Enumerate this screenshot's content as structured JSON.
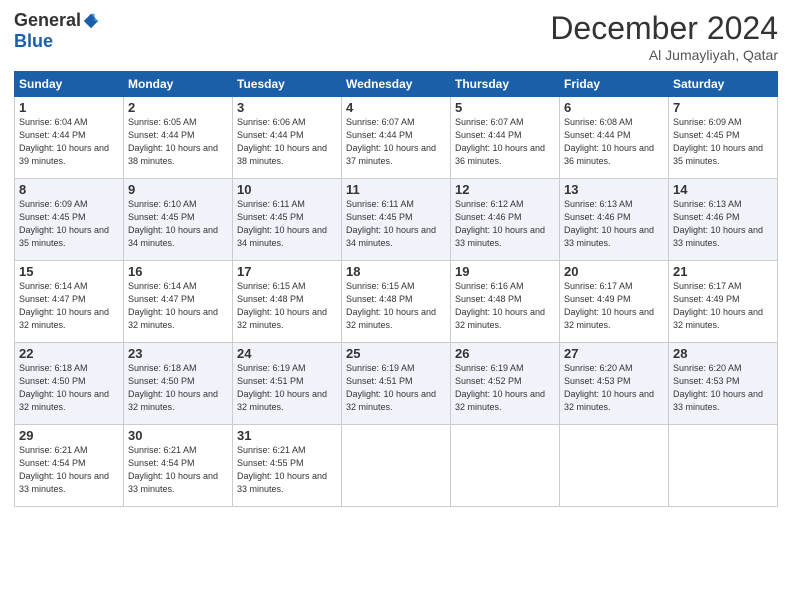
{
  "header": {
    "logo_general": "General",
    "logo_blue": "Blue",
    "month_title": "December 2024",
    "location": "Al Jumayliyah, Qatar"
  },
  "weekdays": [
    "Sunday",
    "Monday",
    "Tuesday",
    "Wednesday",
    "Thursday",
    "Friday",
    "Saturday"
  ],
  "weeks": [
    [
      {
        "day": "1",
        "sunrise": "6:04 AM",
        "sunset": "4:44 PM",
        "daylight": "10 hours and 39 minutes."
      },
      {
        "day": "2",
        "sunrise": "6:05 AM",
        "sunset": "4:44 PM",
        "daylight": "10 hours and 38 minutes."
      },
      {
        "day": "3",
        "sunrise": "6:06 AM",
        "sunset": "4:44 PM",
        "daylight": "10 hours and 38 minutes."
      },
      {
        "day": "4",
        "sunrise": "6:07 AM",
        "sunset": "4:44 PM",
        "daylight": "10 hours and 37 minutes."
      },
      {
        "day": "5",
        "sunrise": "6:07 AM",
        "sunset": "4:44 PM",
        "daylight": "10 hours and 36 minutes."
      },
      {
        "day": "6",
        "sunrise": "6:08 AM",
        "sunset": "4:44 PM",
        "daylight": "10 hours and 36 minutes."
      },
      {
        "day": "7",
        "sunrise": "6:09 AM",
        "sunset": "4:45 PM",
        "daylight": "10 hours and 35 minutes."
      }
    ],
    [
      {
        "day": "8",
        "sunrise": "6:09 AM",
        "sunset": "4:45 PM",
        "daylight": "10 hours and 35 minutes."
      },
      {
        "day": "9",
        "sunrise": "6:10 AM",
        "sunset": "4:45 PM",
        "daylight": "10 hours and 34 minutes."
      },
      {
        "day": "10",
        "sunrise": "6:11 AM",
        "sunset": "4:45 PM",
        "daylight": "10 hours and 34 minutes."
      },
      {
        "day": "11",
        "sunrise": "6:11 AM",
        "sunset": "4:45 PM",
        "daylight": "10 hours and 34 minutes."
      },
      {
        "day": "12",
        "sunrise": "6:12 AM",
        "sunset": "4:46 PM",
        "daylight": "10 hours and 33 minutes."
      },
      {
        "day": "13",
        "sunrise": "6:13 AM",
        "sunset": "4:46 PM",
        "daylight": "10 hours and 33 minutes."
      },
      {
        "day": "14",
        "sunrise": "6:13 AM",
        "sunset": "4:46 PM",
        "daylight": "10 hours and 33 minutes."
      }
    ],
    [
      {
        "day": "15",
        "sunrise": "6:14 AM",
        "sunset": "4:47 PM",
        "daylight": "10 hours and 32 minutes."
      },
      {
        "day": "16",
        "sunrise": "6:14 AM",
        "sunset": "4:47 PM",
        "daylight": "10 hours and 32 minutes."
      },
      {
        "day": "17",
        "sunrise": "6:15 AM",
        "sunset": "4:48 PM",
        "daylight": "10 hours and 32 minutes."
      },
      {
        "day": "18",
        "sunrise": "6:15 AM",
        "sunset": "4:48 PM",
        "daylight": "10 hours and 32 minutes."
      },
      {
        "day": "19",
        "sunrise": "6:16 AM",
        "sunset": "4:48 PM",
        "daylight": "10 hours and 32 minutes."
      },
      {
        "day": "20",
        "sunrise": "6:17 AM",
        "sunset": "4:49 PM",
        "daylight": "10 hours and 32 minutes."
      },
      {
        "day": "21",
        "sunrise": "6:17 AM",
        "sunset": "4:49 PM",
        "daylight": "10 hours and 32 minutes."
      }
    ],
    [
      {
        "day": "22",
        "sunrise": "6:18 AM",
        "sunset": "4:50 PM",
        "daylight": "10 hours and 32 minutes."
      },
      {
        "day": "23",
        "sunrise": "6:18 AM",
        "sunset": "4:50 PM",
        "daylight": "10 hours and 32 minutes."
      },
      {
        "day": "24",
        "sunrise": "6:19 AM",
        "sunset": "4:51 PM",
        "daylight": "10 hours and 32 minutes."
      },
      {
        "day": "25",
        "sunrise": "6:19 AM",
        "sunset": "4:51 PM",
        "daylight": "10 hours and 32 minutes."
      },
      {
        "day": "26",
        "sunrise": "6:19 AM",
        "sunset": "4:52 PM",
        "daylight": "10 hours and 32 minutes."
      },
      {
        "day": "27",
        "sunrise": "6:20 AM",
        "sunset": "4:53 PM",
        "daylight": "10 hours and 32 minutes."
      },
      {
        "day": "28",
        "sunrise": "6:20 AM",
        "sunset": "4:53 PM",
        "daylight": "10 hours and 33 minutes."
      }
    ],
    [
      {
        "day": "29",
        "sunrise": "6:21 AM",
        "sunset": "4:54 PM",
        "daylight": "10 hours and 33 minutes."
      },
      {
        "day": "30",
        "sunrise": "6:21 AM",
        "sunset": "4:54 PM",
        "daylight": "10 hours and 33 minutes."
      },
      {
        "day": "31",
        "sunrise": "6:21 AM",
        "sunset": "4:55 PM",
        "daylight": "10 hours and 33 minutes."
      },
      null,
      null,
      null,
      null
    ]
  ]
}
